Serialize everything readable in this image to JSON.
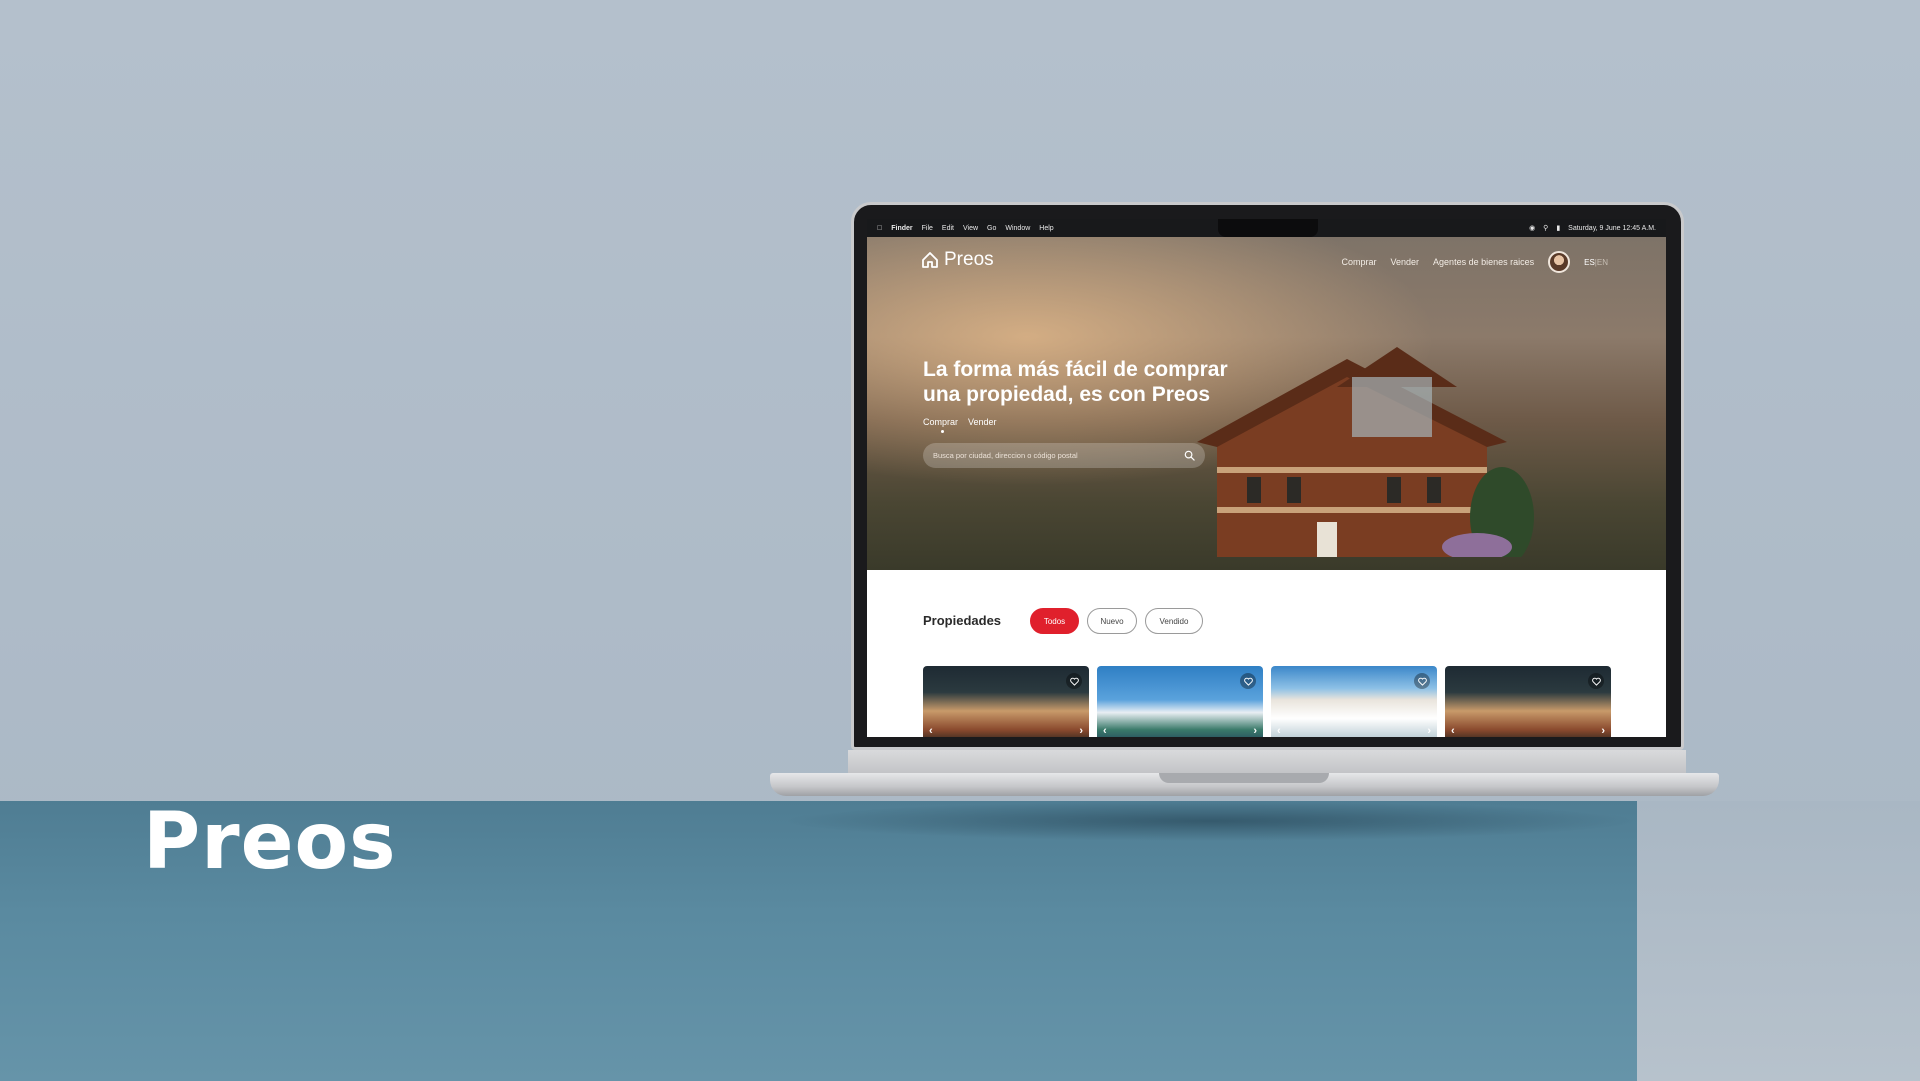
{
  "slide": {
    "brand_title": "Preos"
  },
  "menubar": {
    "items": [
      "Finder",
      "File",
      "Edit",
      "View",
      "Go",
      "Window",
      "Help"
    ],
    "clock": "Saturday, 9 June 12:45 A.M."
  },
  "site": {
    "logo_text": "Preos",
    "nav": [
      "Comprar",
      "Vender",
      "Agentes de bienes raices"
    ],
    "lang_active": "ES",
    "lang_sep": "|",
    "lang_inactive": "EN",
    "hero_title": "La forma más fácil de comprar una propiedad, es con Preos",
    "hero_tabs": [
      "Comprar",
      "Vender"
    ],
    "search_placeholder": "Busca por ciudad, direccion o código postal",
    "properties_title": "Propiedades",
    "filters": [
      "Todos",
      "Nuevo",
      "Vendido"
    ],
    "accent_color": "#e0202c"
  }
}
